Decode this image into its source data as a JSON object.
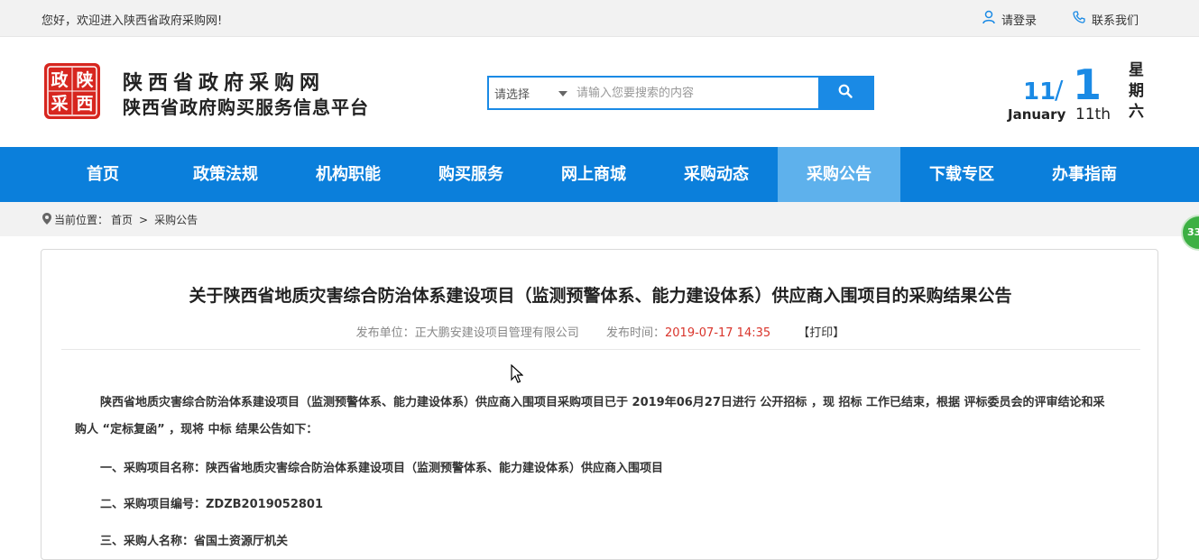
{
  "topbar": {
    "welcome": "您好，欢迎进入陕西省政府采购网!",
    "login": "请登录",
    "contact": "联系我们"
  },
  "header": {
    "logo_text": [
      "政",
      "陕",
      "采",
      "西"
    ],
    "site_title": "陕西省政府采购网",
    "site_subtitle": "陕西省政府购买服务信息平台"
  },
  "search": {
    "select_label": "请选择",
    "placeholder": "请输入您要搜索的内容"
  },
  "date": {
    "month_num": "11",
    "day": "1",
    "month_name": "January",
    "ordinal": "11th",
    "weekday": "星期六"
  },
  "nav": {
    "items": [
      "首页",
      "政策法规",
      "机构职能",
      "购买服务",
      "网上商城",
      "采购动态",
      "采购公告",
      "下载专区",
      "办事指南"
    ],
    "active": "采购公告"
  },
  "breadcrumb": {
    "prefix": "当前位置：",
    "home": "首页",
    "sep": ">",
    "current": "采购公告"
  },
  "announcement": {
    "title": "关于陕西省地质灾害综合防治体系建设项目（监测预警体系、能力建设体系）供应商入围项目的采购结果公告",
    "publisher_label": "发布单位：",
    "publisher": "正大鹏安建设项目管理有限公司",
    "time_label": "发布时间：",
    "time": "2019-07-17 14:35",
    "print": "【打印】",
    "body": "陕西省地质灾害综合防治体系建设项目（监测预警体系、能力建设体系）供应商入围项目采购项目已于 2019年06月27日进行 公开招标 ，现 招标 工作已结束，根据 评标委员会的评审结论和采购人 “定标复函” ，现将 中标 结果公告如下：",
    "items": [
      "一、采购项目名称：陕西省地质灾害综合防治体系建设项目（监测预警体系、能力建设体系）供应商入围项目",
      "二、采购项目编号：ZDZB2019052801",
      "三、采购人名称：省国土资源厅机关"
    ]
  },
  "side_badge": "33"
}
